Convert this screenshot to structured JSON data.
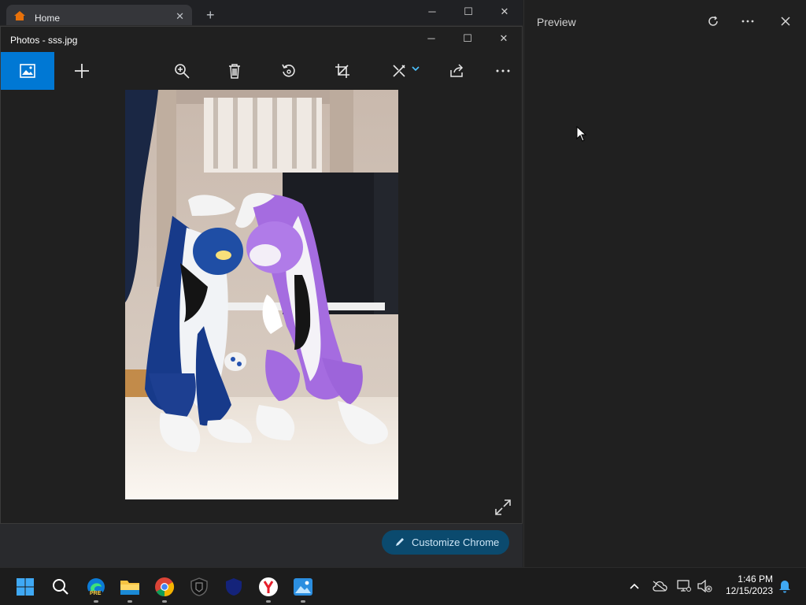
{
  "chrome": {
    "tab_title": "Home",
    "new_tab_symbol": "+",
    "customize_label": "Customize Chrome"
  },
  "photos": {
    "window_title": "Photos - sss.jpg",
    "toolbar": [
      "gallery",
      "add",
      "zoom",
      "delete",
      "rotate",
      "crop",
      "edit",
      "share",
      "more"
    ]
  },
  "preview": {
    "title": "Preview"
  },
  "taskbar": {
    "apps": [
      "start",
      "search",
      "edge-preview",
      "file-explorer",
      "chrome",
      "app-shield",
      "app-blue",
      "yandex",
      "photos"
    ],
    "edge_badge": "PRE",
    "time": "1:46 PM",
    "date": "12/15/2023"
  },
  "colors": {
    "accent": "#0078d4",
    "chrome_customize_bg": "#0b4a6e"
  }
}
